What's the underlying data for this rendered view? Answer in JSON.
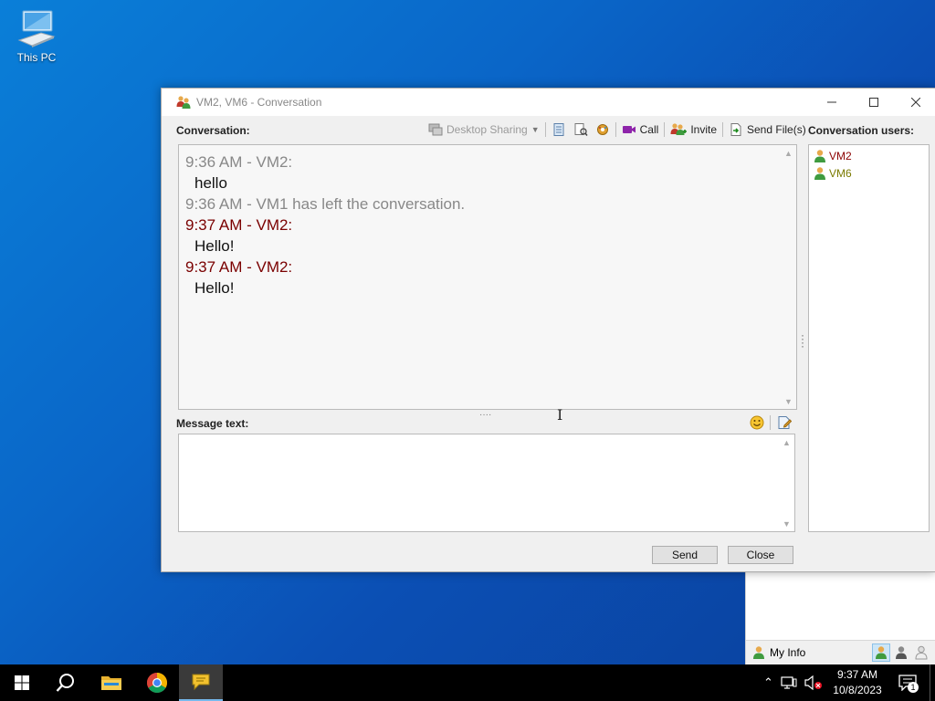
{
  "desktop": {
    "icon_label": "This PC"
  },
  "window": {
    "title": "VM2, VM6 - Conversation",
    "conversation_label": "Conversation:",
    "toolbar": {
      "desktop_sharing": "Desktop Sharing",
      "call": "Call",
      "invite": "Invite",
      "send_files": "Send File(s)"
    },
    "messages": [
      {
        "header": "9:36 AM - VM2:",
        "text": "hello",
        "style": "gray"
      },
      {
        "header": "9:36 AM - VM1 has left the conversation.",
        "text": "",
        "style": "gray"
      },
      {
        "header": "9:37 AM - VM2:",
        "text": "Hello!",
        "style": "red"
      },
      {
        "header": "9:37 AM - VM2:",
        "text": "Hello!",
        "style": "red"
      }
    ],
    "message_label": "Message text:",
    "message_value": "",
    "users_label": "Conversation users:",
    "users": [
      {
        "name": "VM2",
        "color": "#8b0000"
      },
      {
        "name": "VM6",
        "color": "#7a7a00"
      }
    ],
    "buttons": {
      "send": "Send",
      "close": "Close"
    }
  },
  "background_app": {
    "my_info": "My Info"
  },
  "taskbar": {
    "time": "9:37 AM",
    "date": "10/8/2023",
    "notification_count": "1"
  },
  "colors": {
    "header_gray": "#888888",
    "header_red": "#7a0000",
    "taskbar": "#000000"
  }
}
